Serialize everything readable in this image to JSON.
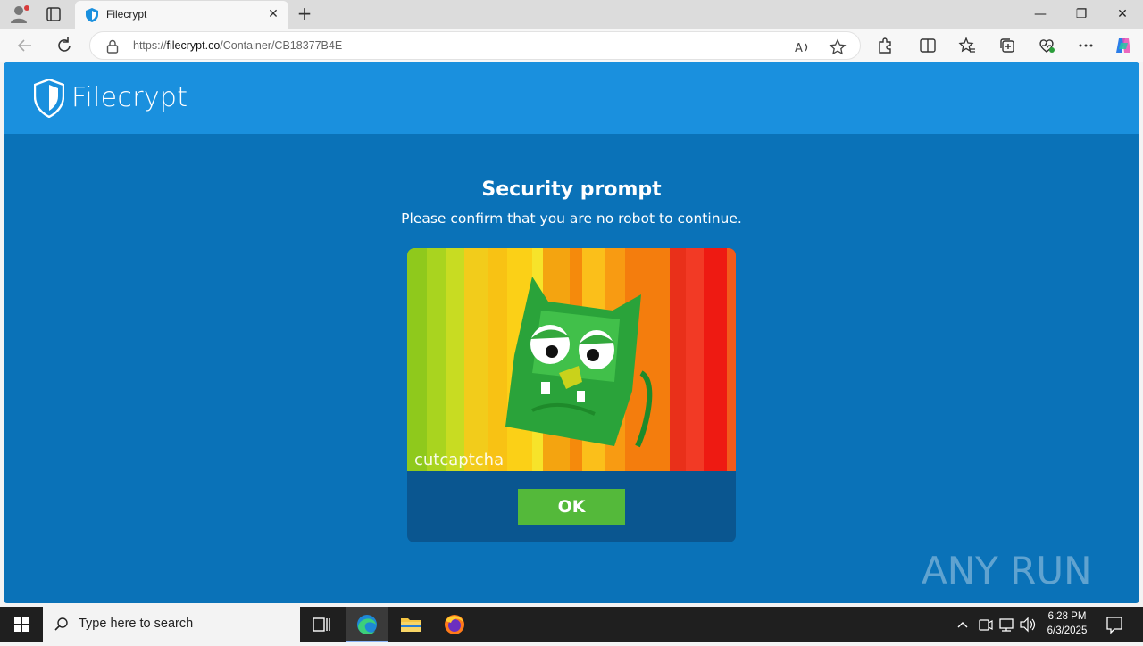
{
  "browser": {
    "tab_title": "Filecrypt",
    "url_domain": "filecrypt.co",
    "url_prefix": "https://",
    "url_path": "/Container/CB18377B4E",
    "new_tab_label": "+",
    "close_tab_label": "✕",
    "minimize_label": "—",
    "restore_label": "❐",
    "close_window_label": "✕"
  },
  "site": {
    "brand": "Filecrypt",
    "prompt_title": "Security prompt",
    "prompt_subtitle": "Please confirm that you are no robot to continue.",
    "captcha_brand": "cutcaptcha",
    "ok_label": "OK",
    "watermark": "ANY RUN"
  },
  "taskbar": {
    "search_placeholder": "Type here to search",
    "time": "6:28 PM",
    "date": "6/3/2025"
  },
  "colors": {
    "page_bg": "#0a72b8",
    "header_bg": "#1a90de",
    "ok_button": "#54b93a",
    "captcha_box": "#0a5690"
  },
  "icons": [
    "profile-icon",
    "tab-actions-icon",
    "shield-favicon",
    "back-icon",
    "refresh-icon",
    "lock-icon",
    "read-aloud-icon",
    "favorite-star-icon",
    "extensions-icon",
    "split-screen-icon",
    "favorites-icon",
    "collections-icon",
    "browser-essentials-icon",
    "more-icon",
    "copilot-icon",
    "windows-start-icon",
    "search-icon",
    "task-view-icon",
    "edge-icon",
    "file-explorer-icon",
    "firefox-icon",
    "chevron-up-icon",
    "meet-now-icon",
    "network-icon",
    "volume-icon",
    "notifications-icon"
  ]
}
